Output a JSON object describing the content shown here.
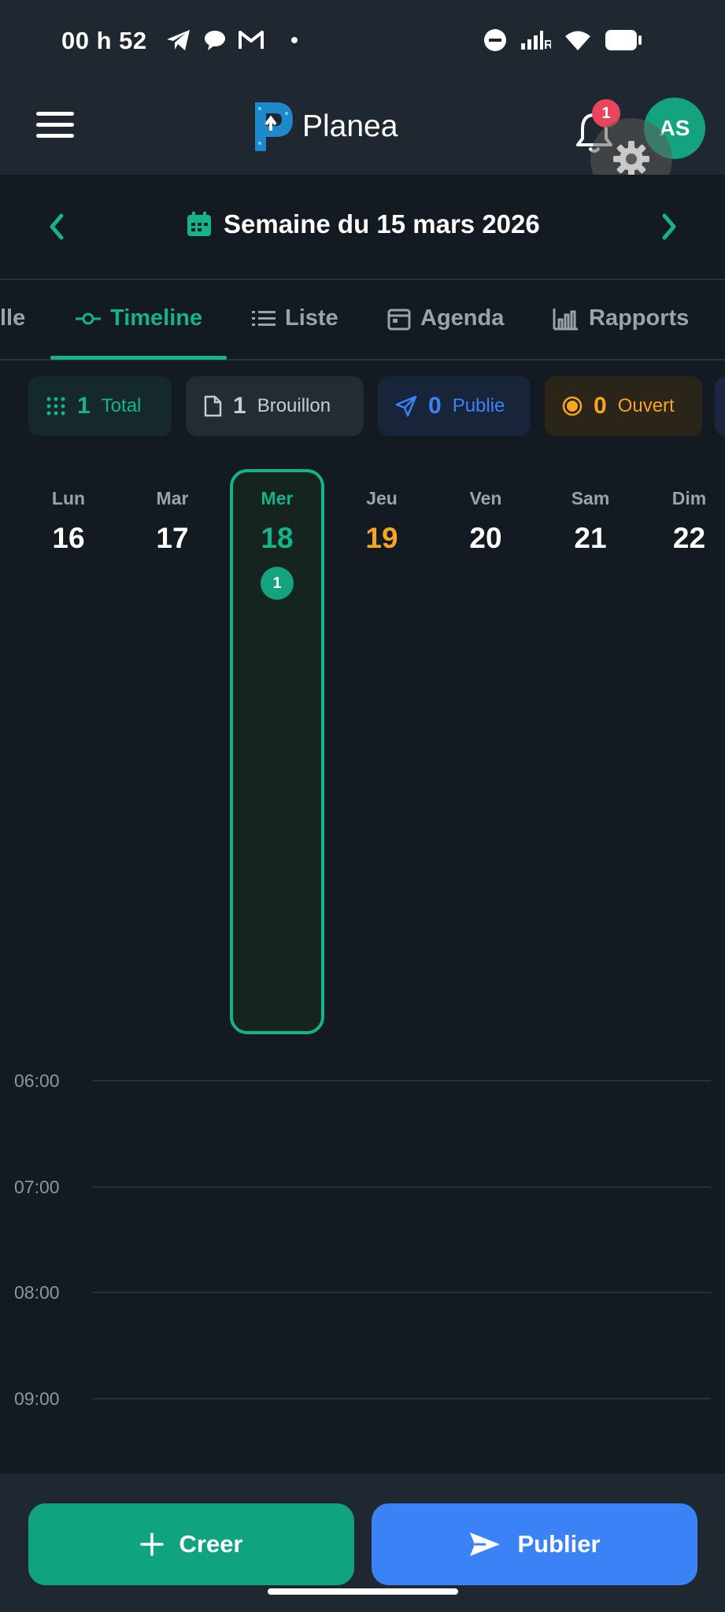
{
  "status_bar": {
    "time": "00 h 52",
    "network": "R"
  },
  "header": {
    "app_name": "Planea",
    "notification_count": "1",
    "avatar_initials": "AS"
  },
  "week": {
    "title": "Semaine du 15 mars 2026"
  },
  "tabs": [
    {
      "label": "lle"
    },
    {
      "label": "Timeline",
      "active": true
    },
    {
      "label": "Liste"
    },
    {
      "label": "Agenda"
    },
    {
      "label": "Rapports"
    }
  ],
  "stats": [
    {
      "count": "1",
      "label": "Total",
      "color": "#14b38a"
    },
    {
      "count": "1",
      "label": "Brouillon",
      "color": "#c7ccd2"
    },
    {
      "count": "0",
      "label": "Publie",
      "color": "#3b82f6"
    },
    {
      "count": "0",
      "label": "Ouvert",
      "color": "#f5a524"
    }
  ],
  "days": [
    {
      "name": "Lun",
      "num": "16"
    },
    {
      "name": "Mar",
      "num": "17"
    },
    {
      "name": "Mer",
      "num": "18",
      "selected": true,
      "count": "1"
    },
    {
      "name": "Jeu",
      "num": "19",
      "today": true
    },
    {
      "name": "Ven",
      "num": "20"
    },
    {
      "name": "Sam",
      "num": "21"
    },
    {
      "name": "Dim",
      "num": "22"
    }
  ],
  "hours": [
    "06:00",
    "07:00",
    "08:00",
    "09:00"
  ],
  "actions": {
    "create_label": "Creer",
    "publish_label": "Publier"
  },
  "colors": {
    "accent": "#14b38a",
    "today": "#f5a524",
    "publish": "#3b82f6",
    "badge": "#e8455e"
  }
}
